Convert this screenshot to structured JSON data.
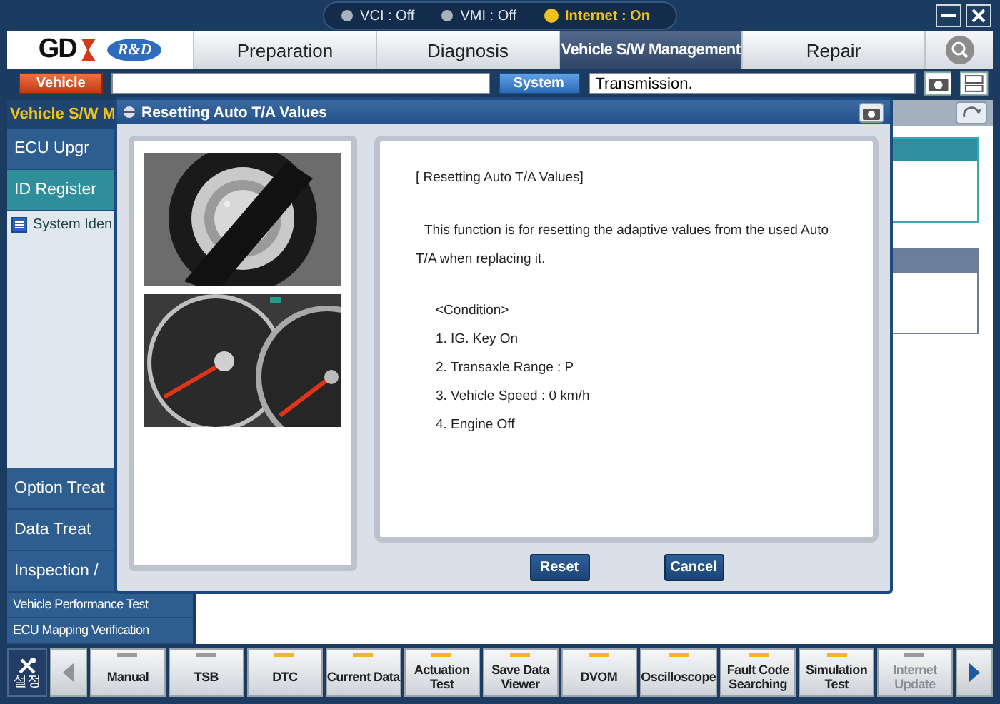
{
  "status_bar": [
    {
      "label": "VCI : Off",
      "on": false
    },
    {
      "label": "VMI : Off",
      "on": false
    },
    {
      "label": "Internet : On",
      "on": true
    }
  ],
  "logo": {
    "text": "GD",
    "badge": "R&D"
  },
  "tabs": [
    {
      "label": "Preparation",
      "selected": false
    },
    {
      "label": "Diagnosis",
      "selected": false
    },
    {
      "label": "Vehicle S/W Management",
      "selected": true
    },
    {
      "label": "Repair",
      "selected": false
    }
  ],
  "selection_bar": {
    "vehicle_button": "Vehicle",
    "system_button": "System",
    "system_value": "Transmission."
  },
  "sidebar": {
    "title": "Vehicle S/W M",
    "items": [
      {
        "kind": "large",
        "label": "ECU Upgr",
        "selected": false
      },
      {
        "kind": "large",
        "label": "ID Register",
        "selected": true
      },
      {
        "kind": "sub",
        "label": "System Iden",
        "selected": false
      },
      {
        "kind": "spacer"
      },
      {
        "kind": "large",
        "label": "Option Treat",
        "selected": false
      },
      {
        "kind": "large",
        "label": "Data Treat",
        "selected": false
      },
      {
        "kind": "large",
        "label": "Inspection /",
        "selected": false
      },
      {
        "kind": "small",
        "label": "Vehicle Performance Test",
        "selected": false
      },
      {
        "kind": "small",
        "label": "ECU Mapping Verification",
        "selected": false
      }
    ]
  },
  "dialog": {
    "title": "Resetting Auto T/A Values",
    "pictures": [
      {
        "kind": "picture"
      },
      {
        "kind": "picture"
      }
    ],
    "lines": [
      {
        "kind": "heading",
        "text": "[ Resetting Auto T/A Values]"
      },
      {
        "kind": "paragraph",
        "text": "This function is for resetting the adaptive values from the used Auto T/A when replacing it."
      },
      {
        "kind": "condition",
        "text": "<Condition>"
      },
      {
        "kind": "condition",
        "text": "1. IG. Key On"
      },
      {
        "kind": "condition",
        "text": "2. Transaxle Range : P"
      },
      {
        "kind": "condition",
        "text": "3. Vehicle Speed : 0 km/h"
      },
      {
        "kind": "condition",
        "text": "4. Engine Off"
      }
    ],
    "buttons": [
      "Reset",
      "Cancel"
    ]
  },
  "toolbar": {
    "settings_label": "설정",
    "buttons": [
      {
        "label": "Manual",
        "on": false,
        "disabled": false
      },
      {
        "label": "TSB",
        "on": false,
        "disabled": false
      },
      {
        "label": "DTC",
        "on": true,
        "disabled": false
      },
      {
        "label": "Current Data",
        "on": true,
        "disabled": false
      },
      {
        "label": "Actuation Test",
        "on": true,
        "disabled": false
      },
      {
        "label": "Save Data Viewer",
        "on": true,
        "disabled": false
      },
      {
        "label": "DVOM",
        "on": true,
        "disabled": false
      },
      {
        "label": "Oscilloscope",
        "on": true,
        "disabled": false
      },
      {
        "label": "Fault Code Searching",
        "on": true,
        "disabled": false
      },
      {
        "label": "Simulation Test",
        "on": true,
        "disabled": false
      },
      {
        "label": "Internet Update",
        "on": false,
        "disabled": true
      }
    ]
  }
}
